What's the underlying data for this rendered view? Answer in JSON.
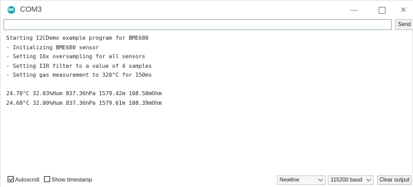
{
  "window": {
    "title": "COM3",
    "minimize_glyph": "—",
    "close_glyph": "✕"
  },
  "send": {
    "input_value": "",
    "button_label": "Send"
  },
  "output": {
    "lines": [
      "Starting I2CDemo example program for BME680",
      "- Initializing BME680 sensor",
      "- Setting 16x oversampling for all sensors",
      "- Setting IIR filter to a value of 4 samples",
      "- Setting gas measurement to 320°C for 150ms",
      "",
      "24.70°C 32.03%Hum 837.36hPa 1579.42m 108.50mOhm",
      "24.68°C 32.00%Hum 837.36hPa 1579.61m 108.39mOhm"
    ]
  },
  "status_bar": {
    "autoscroll_label": "Autoscroll",
    "autoscroll_checked": true,
    "timestamp_label": "Show timestamp",
    "timestamp_checked": false,
    "line_ending": "Newline",
    "baud_rate": "115200 baud",
    "clear_label": "Clear output"
  },
  "colors": {
    "accent": "#1aa3a8",
    "input_border": "#9db6c9"
  },
  "icons": {
    "app": "arduino-icon",
    "dropdown": "chevron-down-icon"
  }
}
